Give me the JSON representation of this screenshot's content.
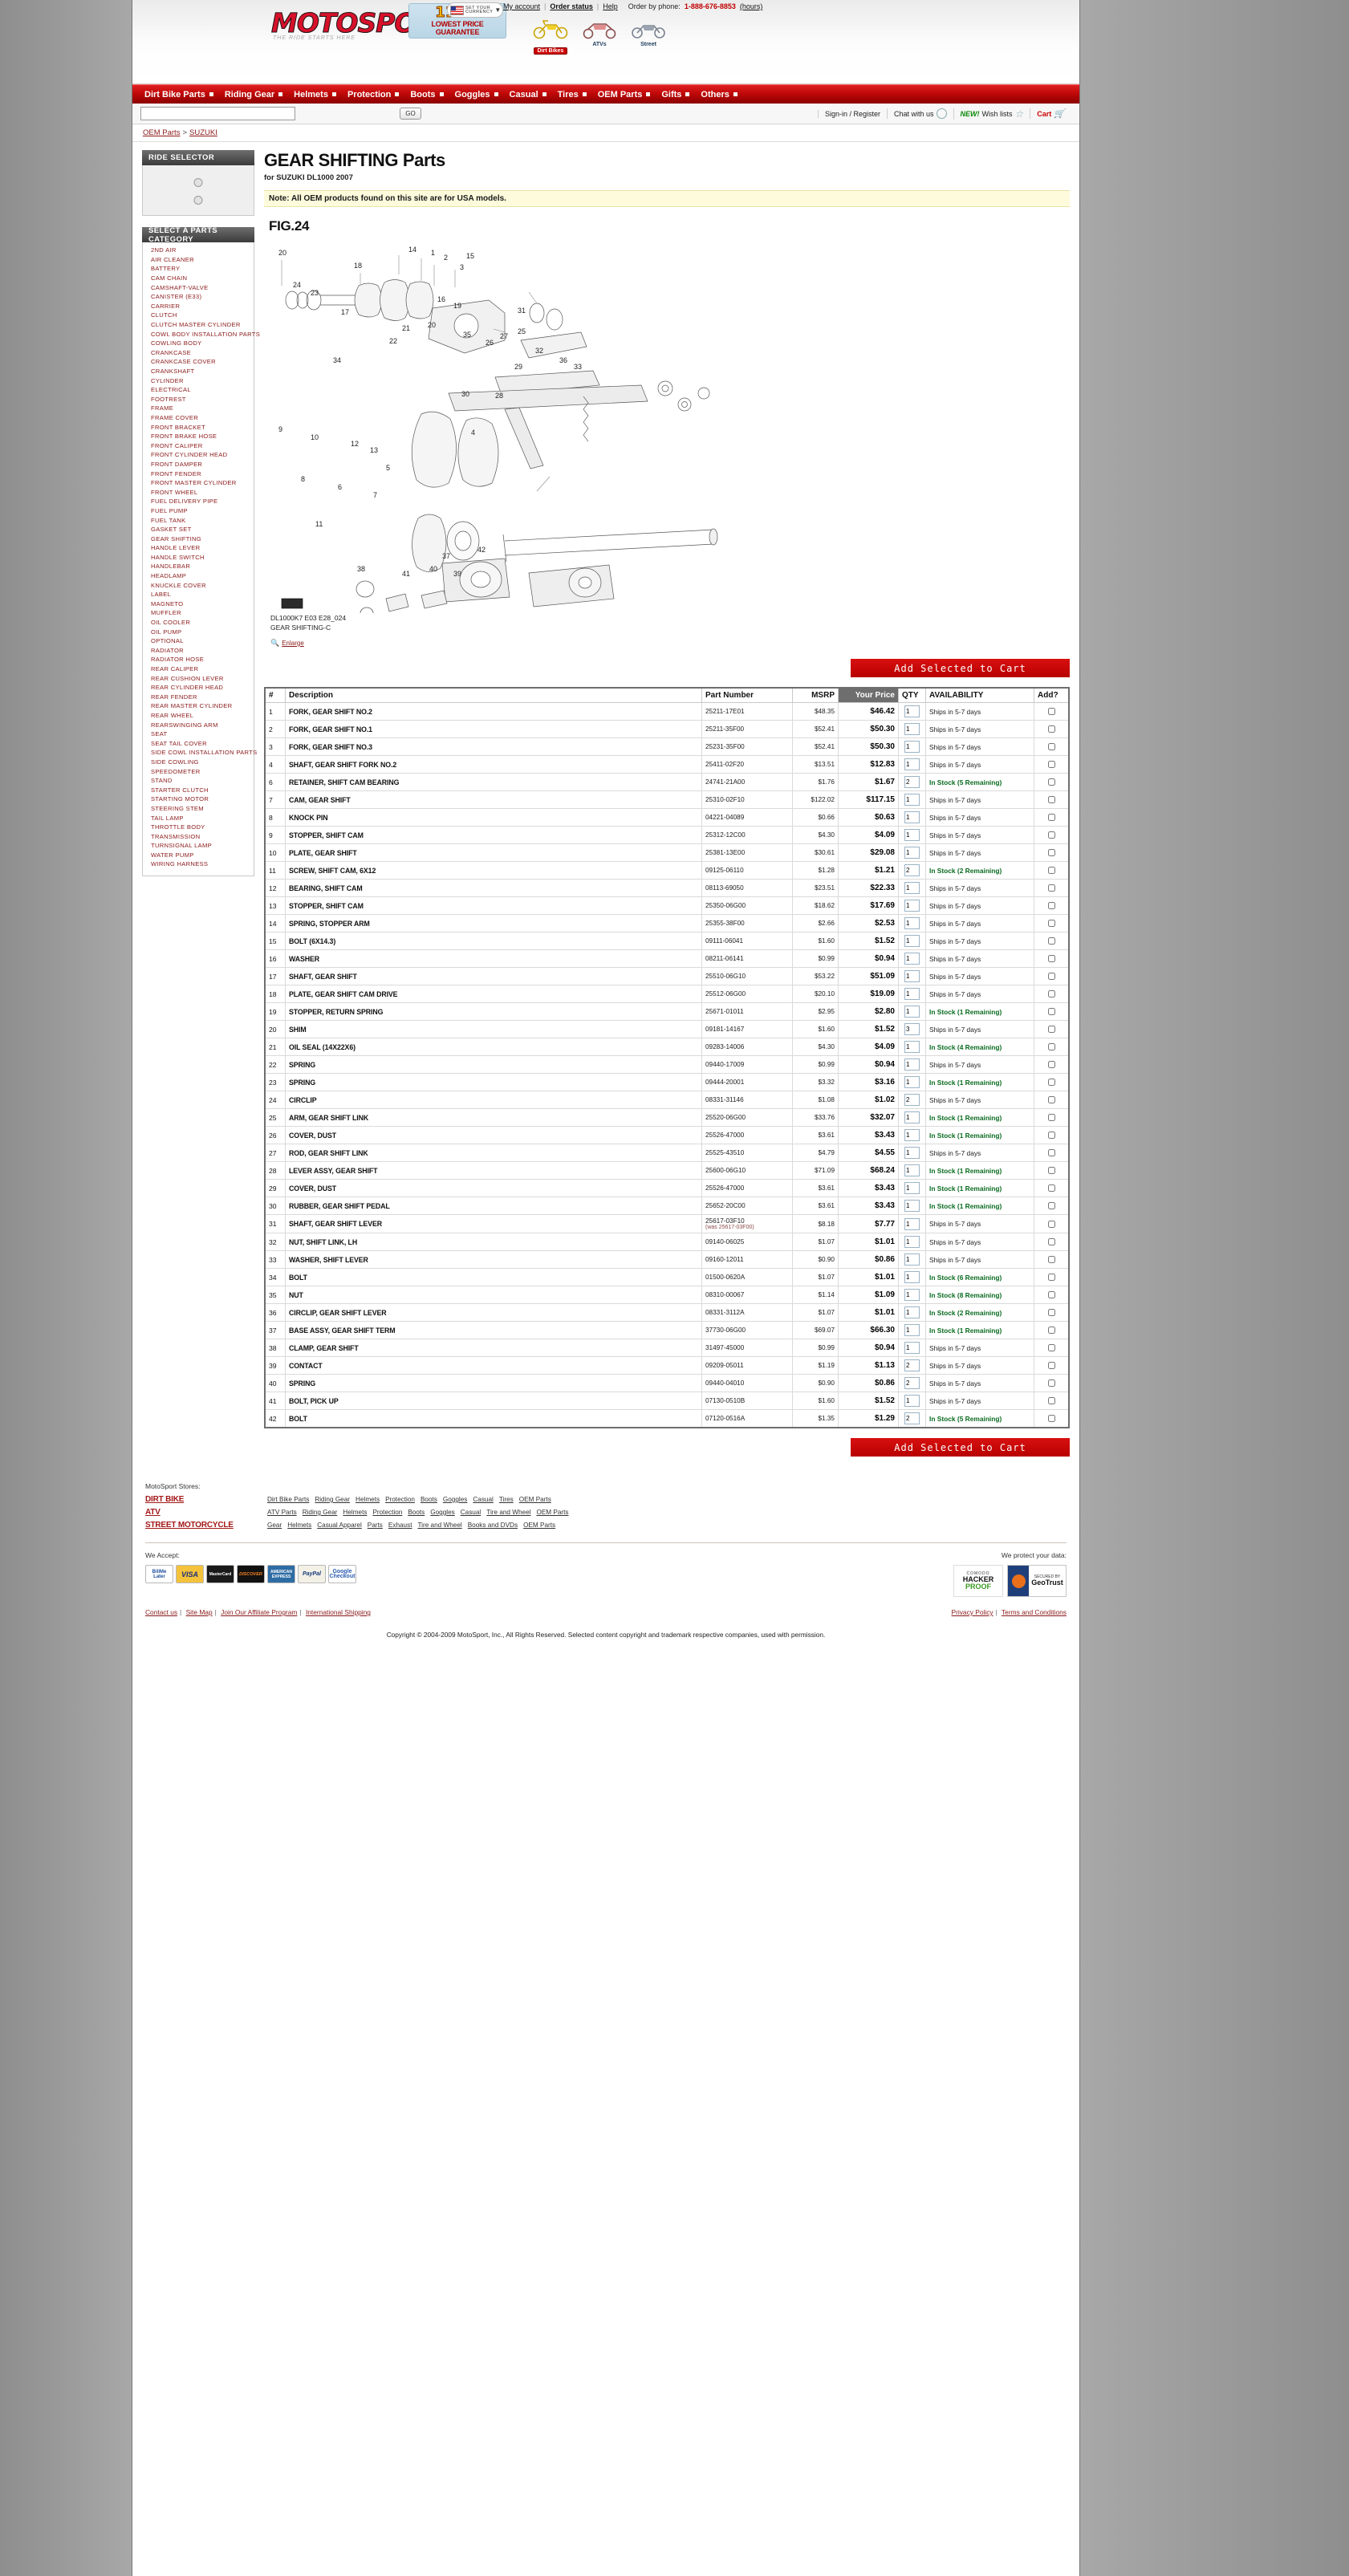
{
  "header": {
    "logo_text": "MOTOSPORT",
    "logo_sub": "THE RIDE STARTS HERE",
    "guarantee_pct": "110%",
    "guarantee_line1": "LOWEST PRICE",
    "guarantee_line2": "GUARANTEE",
    "currency_line1": "SET  YOUR",
    "currency_line2": "CURRENCY",
    "my_account": "My account",
    "order_status": "Order status",
    "help": "Help",
    "order_by_phone": "Order by phone:",
    "phone": "1-888-676-8853",
    "hours": "(hours)",
    "rides": [
      {
        "label": "Dirt Bikes",
        "selected": true
      },
      {
        "label": "ATVs",
        "selected": false
      },
      {
        "label": "Street",
        "selected": false
      }
    ]
  },
  "nav": {
    "items": [
      "Dirt Bike Parts",
      "Riding Gear",
      "Helmets",
      "Protection",
      "Boots",
      "Goggles",
      "Casual",
      "Tires",
      "OEM Parts",
      "Gifts",
      "Others"
    ]
  },
  "search": {
    "value": "",
    "placeholder": "",
    "go_label": "GO",
    "signin": "Sign-in / Register",
    "chat": "Chat with us",
    "new_badge": "NEW!",
    "wishlists": "Wish lists",
    "cart": "Cart"
  },
  "breadcrumb": {
    "items": [
      "OEM Parts",
      "SUZUKI"
    ],
    "separator": ">"
  },
  "sidebar": {
    "ride_selector_title": "RIDE SELECTOR",
    "category_title": "SELECT A PARTS CATEGORY",
    "categories": [
      "2ND AIR",
      "AIR CLEANER",
      "BATTERY",
      "CAM CHAIN",
      "CAMSHAFT-VALVE",
      "CANISTER (E33)",
      "CARRIER",
      "CLUTCH",
      "CLUTCH MASTER CYLINDER",
      "COWL BODY INSTALLATION PARTS",
      "COWLING BODY",
      "CRANKCASE",
      "CRANKCASE COVER",
      "CRANKSHAFT",
      "CYLINDER",
      "ELECTRICAL",
      "FOOTREST",
      "FRAME",
      "FRAME COVER",
      "FRONT BRACKET",
      "FRONT BRAKE HOSE",
      "FRONT CALIPER",
      "FRONT CYLINDER HEAD",
      "FRONT DAMPER",
      "FRONT FENDER",
      "FRONT MASTER CYLINDER",
      "FRONT WHEEL",
      "FUEL DELIVERY PIPE",
      "FUEL PUMP",
      "FUEL TANK",
      "GASKET SET",
      "GEAR SHIFTING",
      "HANDLE LEVER",
      "HANDLE SWITCH",
      "HANDLEBAR",
      "HEADLAMP",
      "KNUCKLE COVER",
      "LABEL",
      "MAGNETO",
      "MUFFLER",
      "OIL COOLER",
      "OIL PUMP",
      "OPTIONAL",
      "RADIATOR",
      "RADIATOR HOSE",
      "REAR CALIPER",
      "REAR CUSHION LEVER",
      "REAR CYLINDER HEAD",
      "REAR FENDER",
      "REAR MASTER CYLINDER",
      "REAR WHEEL",
      "REARSWINGING ARM",
      "SEAT",
      "SEAT TAIL COVER",
      "SIDE COWL INSTALLATION PARTS",
      "SIDE COWLING",
      "SPEEDOMETER",
      "STAND",
      "STARTER CLUTCH",
      "STARTING MOTOR",
      "STEERING STEM",
      "TAIL LAMP",
      "THROTTLE BODY",
      "TRANSMISSION",
      "TURNSIGNAL LAMP",
      "WATER PUMP",
      "WIRING HARNESS"
    ]
  },
  "main": {
    "title": "GEAR SHIFTING Parts",
    "subtitle": "for SUZUKI DL1000 2007",
    "note": "Note: All OEM products found on this site are for USA models.",
    "fig_label": "FIG.24",
    "diagram_caption_line1": "DL1000K7 E03 E28_024",
    "diagram_caption_line2": "GEAR SHIFTING-C",
    "enlarge_label": "Enlarge",
    "add_to_cart_label": "Add Selected to Cart",
    "diagram_callouts": [
      "20",
      "14",
      "1",
      "2",
      "3",
      "15",
      "18",
      "24",
      "23",
      "17",
      "16",
      "19",
      "21",
      "22",
      "20",
      "31",
      "26",
      "27",
      "25",
      "35",
      "34",
      "32",
      "29",
      "36",
      "33",
      "30",
      "28",
      "9",
      "10",
      "12",
      "13",
      "5",
      "4",
      "8",
      "6",
      "7",
      "11",
      "38",
      "41",
      "40",
      "39",
      "37",
      "42"
    ]
  },
  "table": {
    "columns": [
      "#",
      "Description",
      "Part Number",
      "MSRP",
      "Your Price",
      "QTY",
      "AVAILABILITY",
      "Add?"
    ],
    "rows": [
      {
        "n": "1",
        "desc": "FORK, GEAR SHIFT NO.2",
        "pn": "25211-17E01",
        "was": "",
        "msrp": "$48.35",
        "price": "$46.42",
        "qty": "1",
        "avail": "Ships in 5-7 days",
        "stock": false
      },
      {
        "n": "2",
        "desc": "FORK, GEAR SHIFT NO.1",
        "pn": "25211-35F00",
        "was": "",
        "msrp": "$52.41",
        "price": "$50.30",
        "qty": "1",
        "avail": "Ships in 5-7 days",
        "stock": false
      },
      {
        "n": "3",
        "desc": "FORK, GEAR SHIFT NO.3",
        "pn": "25231-35F00",
        "was": "",
        "msrp": "$52.41",
        "price": "$50.30",
        "qty": "1",
        "avail": "Ships in 5-7 days",
        "stock": false
      },
      {
        "n": "4",
        "desc": "SHAFT, GEAR SHIFT FORK NO.2",
        "pn": "25411-02F20",
        "was": "",
        "msrp": "$13.51",
        "price": "$12.83",
        "qty": "1",
        "avail": "Ships in 5-7 days",
        "stock": false
      },
      {
        "n": "6",
        "desc": "RETAINER, SHIFT CAM BEARING",
        "pn": "24741-21A00",
        "was": "",
        "msrp": "$1.76",
        "price": "$1.67",
        "qty": "2",
        "avail": "In Stock (5 Remaining)",
        "stock": true
      },
      {
        "n": "7",
        "desc": "CAM, GEAR SHIFT",
        "pn": "25310-02F10",
        "was": "",
        "msrp": "$122.02",
        "price": "$117.15",
        "qty": "1",
        "avail": "Ships in 5-7 days",
        "stock": false
      },
      {
        "n": "8",
        "desc": "KNOCK PIN",
        "pn": "04221-04089",
        "was": "",
        "msrp": "$0.66",
        "price": "$0.63",
        "qty": "1",
        "avail": "Ships in 5-7 days",
        "stock": false
      },
      {
        "n": "9",
        "desc": "STOPPER, SHIFT CAM",
        "pn": "25312-12C00",
        "was": "",
        "msrp": "$4.30",
        "price": "$4.09",
        "qty": "1",
        "avail": "Ships in 5-7 days",
        "stock": false
      },
      {
        "n": "10",
        "desc": "PLATE, GEAR SHIFT",
        "pn": "25381-13E00",
        "was": "",
        "msrp": "$30.61",
        "price": "$29.08",
        "qty": "1",
        "avail": "Ships in 5-7 days",
        "stock": false
      },
      {
        "n": "11",
        "desc": "SCREW, SHIFT CAM, 6X12",
        "pn": "09125-06110",
        "was": "",
        "msrp": "$1.28",
        "price": "$1.21",
        "qty": "2",
        "avail": "In Stock (2 Remaining)",
        "stock": true
      },
      {
        "n": "12",
        "desc": "BEARING, SHIFT CAM",
        "pn": "08113-69050",
        "was": "",
        "msrp": "$23.51",
        "price": "$22.33",
        "qty": "1",
        "avail": "Ships in 5-7 days",
        "stock": false
      },
      {
        "n": "13",
        "desc": "STOPPER, SHIFT CAM",
        "pn": "25350-06G00",
        "was": "",
        "msrp": "$18.62",
        "price": "$17.69",
        "qty": "1",
        "avail": "Ships in 5-7 days",
        "stock": false
      },
      {
        "n": "14",
        "desc": "SPRING, STOPPER ARM",
        "pn": "25355-38F00",
        "was": "",
        "msrp": "$2.66",
        "price": "$2.53",
        "qty": "1",
        "avail": "Ships in 5-7 days",
        "stock": false
      },
      {
        "n": "15",
        "desc": "BOLT (6X14.3)",
        "pn": "09111-06041",
        "was": "",
        "msrp": "$1.60",
        "price": "$1.52",
        "qty": "1",
        "avail": "Ships in 5-7 days",
        "stock": false
      },
      {
        "n": "16",
        "desc": "WASHER",
        "pn": "08211-06141",
        "was": "",
        "msrp": "$0.99",
        "price": "$0.94",
        "qty": "1",
        "avail": "Ships in 5-7 days",
        "stock": false
      },
      {
        "n": "17",
        "desc": "SHAFT, GEAR SHIFT",
        "pn": "25510-06G10",
        "was": "",
        "msrp": "$53.22",
        "price": "$51.09",
        "qty": "1",
        "avail": "Ships in 5-7 days",
        "stock": false
      },
      {
        "n": "18",
        "desc": "PLATE, GEAR SHIFT CAM DRIVE",
        "pn": "25512-06G00",
        "was": "",
        "msrp": "$20.10",
        "price": "$19.09",
        "qty": "1",
        "avail": "Ships in 5-7 days",
        "stock": false
      },
      {
        "n": "19",
        "desc": "STOPPER, RETURN SPRING",
        "pn": "25671-01011",
        "was": "",
        "msrp": "$2.95",
        "price": "$2.80",
        "qty": "1",
        "avail": "In Stock (1 Remaining)",
        "stock": true
      },
      {
        "n": "20",
        "desc": "SHIM",
        "pn": "09181-14167",
        "was": "",
        "msrp": "$1.60",
        "price": "$1.52",
        "qty": "3",
        "avail": "Ships in 5-7 days",
        "stock": false
      },
      {
        "n": "21",
        "desc": "OIL SEAL (14X22X6)",
        "pn": "09283-14006",
        "was": "",
        "msrp": "$4.30",
        "price": "$4.09",
        "qty": "1",
        "avail": "In Stock (4 Remaining)",
        "stock": true
      },
      {
        "n": "22",
        "desc": "SPRING",
        "pn": "09440-17009",
        "was": "",
        "msrp": "$0.99",
        "price": "$0.94",
        "qty": "1",
        "avail": "Ships in 5-7 days",
        "stock": false
      },
      {
        "n": "23",
        "desc": "SPRING",
        "pn": "09444-20001",
        "was": "",
        "msrp": "$3.32",
        "price": "$3.16",
        "qty": "1",
        "avail": "In Stock (1 Remaining)",
        "stock": true
      },
      {
        "n": "24",
        "desc": "CIRCLIP",
        "pn": "08331-31146",
        "was": "",
        "msrp": "$1.08",
        "price": "$1.02",
        "qty": "2",
        "avail": "Ships in 5-7 days",
        "stock": false
      },
      {
        "n": "25",
        "desc": "ARM, GEAR SHIFT LINK",
        "pn": "25520-06G00",
        "was": "",
        "msrp": "$33.76",
        "price": "$32.07",
        "qty": "1",
        "avail": "In Stock (1 Remaining)",
        "stock": true
      },
      {
        "n": "26",
        "desc": "COVER, DUST",
        "pn": "25526-47000",
        "was": "",
        "msrp": "$3.61",
        "price": "$3.43",
        "qty": "1",
        "avail": "In Stock (1 Remaining)",
        "stock": true
      },
      {
        "n": "27",
        "desc": "ROD, GEAR SHIFT LINK",
        "pn": "25525-43510",
        "was": "",
        "msrp": "$4.79",
        "price": "$4.55",
        "qty": "1",
        "avail": "Ships in 5-7 days",
        "stock": false
      },
      {
        "n": "28",
        "desc": "LEVER ASSY, GEAR SHIFT",
        "pn": "25600-06G10",
        "was": "",
        "msrp": "$71.09",
        "price": "$68.24",
        "qty": "1",
        "avail": "In Stock (1 Remaining)",
        "stock": true
      },
      {
        "n": "29",
        "desc": "COVER, DUST",
        "pn": "25526-47000",
        "was": "",
        "msrp": "$3.61",
        "price": "$3.43",
        "qty": "1",
        "avail": "In Stock (1 Remaining)",
        "stock": true
      },
      {
        "n": "30",
        "desc": "RUBBER, GEAR SHIFT PEDAL",
        "pn": "25652-20C00",
        "was": "",
        "msrp": "$3.61",
        "price": "$3.43",
        "qty": "1",
        "avail": "In Stock (1 Remaining)",
        "stock": true
      },
      {
        "n": "31",
        "desc": "SHAFT, GEAR SHIFT LEVER",
        "pn": "25617-03F10",
        "was": "(was 25617-03F00)",
        "msrp": "$8.18",
        "price": "$7.77",
        "qty": "1",
        "avail": "Ships in 5-7 days",
        "stock": false
      },
      {
        "n": "32",
        "desc": "NUT, SHIFT LINK, LH",
        "pn": "09140-06025",
        "was": "",
        "msrp": "$1.07",
        "price": "$1.01",
        "qty": "1",
        "avail": "Ships in 5-7 days",
        "stock": false
      },
      {
        "n": "33",
        "desc": "WASHER, SHIFT LEVER",
        "pn": "09160-12011",
        "was": "",
        "msrp": "$0.90",
        "price": "$0.86",
        "qty": "1",
        "avail": "Ships in 5-7 days",
        "stock": false
      },
      {
        "n": "34",
        "desc": "BOLT",
        "pn": "01500-0620A",
        "was": "",
        "msrp": "$1.07",
        "price": "$1.01",
        "qty": "1",
        "avail": "In Stock (6 Remaining)",
        "stock": true
      },
      {
        "n": "35",
        "desc": "NUT",
        "pn": "08310-00067",
        "was": "",
        "msrp": "$1.14",
        "price": "$1.09",
        "qty": "1",
        "avail": "In Stock (8 Remaining)",
        "stock": true
      },
      {
        "n": "36",
        "desc": "CIRCLIP, GEAR SHIFT LEVER",
        "pn": "08331-3112A",
        "was": "",
        "msrp": "$1.07",
        "price": "$1.01",
        "qty": "1",
        "avail": "In Stock (2 Remaining)",
        "stock": true
      },
      {
        "n": "37",
        "desc": "BASE ASSY, GEAR SHIFT TERM",
        "pn": "37730-06G00",
        "was": "",
        "msrp": "$69.07",
        "price": "$66.30",
        "qty": "1",
        "avail": "In Stock (1 Remaining)",
        "stock": true
      },
      {
        "n": "38",
        "desc": "CLAMP, GEAR SHIFT",
        "pn": "31497-45000",
        "was": "",
        "msrp": "$0.99",
        "price": "$0.94",
        "qty": "1",
        "avail": "Ships in 5-7 days",
        "stock": false
      },
      {
        "n": "39",
        "desc": "CONTACT",
        "pn": "09209-05011",
        "was": "",
        "msrp": "$1.19",
        "price": "$1.13",
        "qty": "2",
        "avail": "Ships in 5-7 days",
        "stock": false
      },
      {
        "n": "40",
        "desc": "SPRING",
        "pn": "09440-04010",
        "was": "",
        "msrp": "$0.90",
        "price": "$0.86",
        "qty": "2",
        "avail": "Ships in 5-7 days",
        "stock": false
      },
      {
        "n": "41",
        "desc": "BOLT, PICK UP",
        "pn": "07130-0510B",
        "was": "",
        "msrp": "$1.60",
        "price": "$1.52",
        "qty": "1",
        "avail": "Ships in 5-7 days",
        "stock": false
      },
      {
        "n": "42",
        "desc": "BOLT",
        "pn": "07120-0516A",
        "was": "",
        "msrp": "$1.35",
        "price": "$1.29",
        "qty": "2",
        "avail": "In Stock (5 Remaining)",
        "stock": true
      }
    ]
  },
  "footer": {
    "stores_label": "MotoSport Stores:",
    "stores": [
      {
        "name": "DIRT BIKE",
        "links": [
          "Dirt Bike Parts",
          "Riding Gear",
          "Helmets",
          "Protection",
          "Boots",
          "Goggles",
          "Casual",
          "Tires",
          "OEM Parts"
        ]
      },
      {
        "name": "ATV",
        "links": [
          "ATV Parts",
          "Riding Gear",
          "Helmets",
          "Protection",
          "Boots",
          "Goggles",
          "Casual",
          "Tire and Wheel",
          "OEM Parts"
        ]
      },
      {
        "name": "STREET MOTORCYCLE",
        "links": [
          "Gear",
          "Helmets",
          "Casual Apparel",
          "Parts",
          "Exhaust",
          "Tire and Wheel",
          "Books and DVDs",
          "OEM Parts"
        ]
      }
    ],
    "we_accept": "We Accept:",
    "we_protect": "We protect your data:",
    "cards": [
      "BillMe Later",
      "VISA",
      "MasterCard",
      "DISCOVER",
      "AMERICAN EXPRESS",
      "PayPal",
      "Google Checkout"
    ],
    "seal1_top": "COMODO",
    "seal1_mid": "HACKER",
    "seal1_bot": "PROOF",
    "seal2_small": "SECURED BY",
    "seal2_big": "GeoTrust",
    "left_links": [
      "Contact us",
      "Site Map",
      "Join Our Affiliate Program",
      "International Shipping"
    ],
    "right_links": [
      "Privacy Policy",
      "Terms and Conditions"
    ],
    "copyright": "Copyright © 2004-2009 MotoSport, Inc., All Rights Reserved. Selected content copyright and trademark respective companies, used with permission."
  },
  "colors": {
    "brand_red": "#c00000",
    "link_red": "#8b1a1a",
    "in_stock_green": "#0a6b20",
    "note_yellow": "#fdfbdc"
  }
}
